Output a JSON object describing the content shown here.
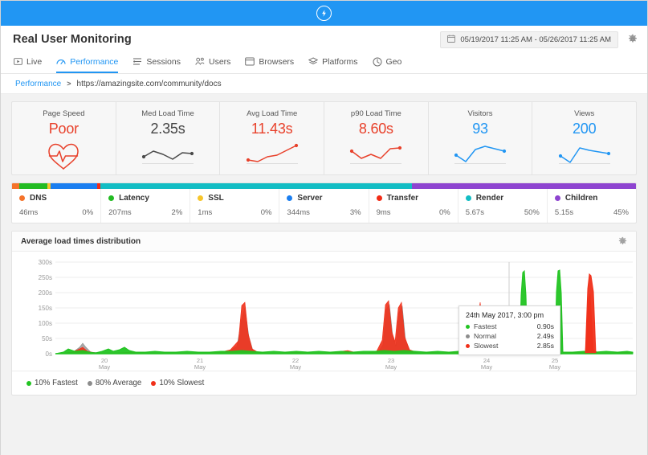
{
  "header": {
    "logo_icon": "lightning-bolt-circle-icon",
    "bar_color": "#2196f3"
  },
  "title_bar": {
    "title": "Real User Monitoring",
    "date_range": "05/19/2017 11:25 AM - 05/26/2017 11:25 AM",
    "calendar_icon": "calendar-icon",
    "settings_icon": "gear-icon"
  },
  "tabs": [
    {
      "label": "Live",
      "icon": "live-play-icon",
      "active": false
    },
    {
      "label": "Performance",
      "icon": "gauge-icon",
      "active": true
    },
    {
      "label": "Sessions",
      "icon": "sessions-list-icon",
      "active": false
    },
    {
      "label": "Users",
      "icon": "users-icon",
      "active": false
    },
    {
      "label": "Browsers",
      "icon": "browser-window-icon",
      "active": false
    },
    {
      "label": "Platforms",
      "icon": "layers-icon",
      "active": false
    },
    {
      "label": "Geo",
      "icon": "globe-clock-icon",
      "active": false
    }
  ],
  "breadcrumb": {
    "root": "Performance",
    "separator": ">",
    "current": "https://amazingsite.com/community/docs"
  },
  "metrics": [
    {
      "label": "Page Speed",
      "value": "Poor",
      "color": "#e8412b",
      "spark": "heart-pulse-icon"
    },
    {
      "label": "Med Load Time",
      "value": "2.35s",
      "color": "#444444",
      "spark": "sparkline"
    },
    {
      "label": "Avg Load Time",
      "value": "11.43s",
      "color": "#e8412b",
      "spark": "sparkline"
    },
    {
      "label": "p90 Load Time",
      "value": "8.60s",
      "color": "#e8412b",
      "spark": "sparkline"
    },
    {
      "label": "Visitors",
      "value": "93",
      "color": "#2196f3",
      "spark": "sparkline"
    },
    {
      "label": "Views",
      "value": "200",
      "color": "#2196f3",
      "spark": "sparkline"
    }
  ],
  "breakdown": {
    "segments": [
      {
        "name": "DNS",
        "time": "46ms",
        "percent": "0%",
        "color": "#f5732a",
        "width": 1.2
      },
      {
        "name": "Latency",
        "time": "207ms",
        "percent": "2%",
        "color": "#22bb22",
        "width": 4.5
      },
      {
        "name": "SSL",
        "time": "1ms",
        "percent": "0%",
        "color": "#f7c52b",
        "width": 0.5
      },
      {
        "name": "Server",
        "time": "344ms",
        "percent": "3%",
        "color": "#1a7ef0",
        "width": 7.5
      },
      {
        "name": "Transfer",
        "time": "9ms",
        "percent": "0%",
        "color": "#f22b15",
        "width": 0.4
      },
      {
        "name": "Render",
        "time": "5.67s",
        "percent": "50%",
        "color": "#12bdc4",
        "width": 50
      },
      {
        "name": "Children",
        "time": "5.15s",
        "percent": "45%",
        "color": "#8e44d0",
        "width": 35.9
      }
    ]
  },
  "chart_panel": {
    "title": "Average load times distribution",
    "settings_icon": "gear-icon"
  },
  "chart_data": {
    "type": "area",
    "title": "Average load times distribution",
    "xlabel": "",
    "ylabel": "",
    "ylim": [
      0,
      320
    ],
    "yticks": [
      "0s",
      "50s",
      "100s",
      "150s",
      "200s",
      "250s",
      "300s"
    ],
    "ytick_values": [
      0,
      50,
      100,
      150,
      200,
      250,
      300
    ],
    "xticks": [
      "20\nMay",
      "21\nMay",
      "22\nMay",
      "23\nMay",
      "24\nMay",
      "25\nMay"
    ],
    "xtick_labels": [
      {
        "day": "20",
        "month": "May"
      },
      {
        "day": "21",
        "month": "May"
      },
      {
        "day": "22",
        "month": "May"
      },
      {
        "day": "23",
        "month": "May"
      },
      {
        "day": "24",
        "month": "May"
      },
      {
        "day": "25",
        "month": "May"
      }
    ],
    "grid": true,
    "legend_position": "bottom",
    "series": [
      {
        "name": "10% Fastest",
        "color": "#22c422",
        "peaks": [
          {
            "x": 62,
            "y": 290
          },
          {
            "x": 73,
            "y": 290
          },
          {
            "x": 7,
            "y": 12
          },
          {
            "x": 14,
            "y": 10
          },
          {
            "x": 22,
            "y": 14
          }
        ]
      },
      {
        "name": "80% Average",
        "color": "#8c8c8c",
        "peaks": [
          {
            "x": 6,
            "y": 32
          },
          {
            "x": 39,
            "y": 128
          },
          {
            "x": 52,
            "y": 150
          },
          {
            "x": 55,
            "y": 148
          },
          {
            "x": 67,
            "y": 122
          }
        ]
      },
      {
        "name": "10% Slowest",
        "color": "#f0301a",
        "peaks": [
          {
            "x": 39,
            "y": 152
          },
          {
            "x": 52,
            "y": 168
          },
          {
            "x": 55,
            "y": 165
          },
          {
            "x": 67,
            "y": 150
          },
          {
            "x": 84,
            "y": 268
          }
        ]
      }
    ]
  },
  "tooltip": {
    "title": "24th May 2017, 3:00 pm",
    "rows": [
      {
        "name": "Fastest",
        "value": "0.90s",
        "color": "#22c422"
      },
      {
        "name": "Normal",
        "value": "2.49s",
        "color": "#8c8c8c"
      },
      {
        "name": "Slowest",
        "value": "2.85s",
        "color": "#f0301a"
      }
    ]
  },
  "chart_legend": [
    {
      "label": "10% Fastest",
      "color": "#22c422"
    },
    {
      "label": "80% Average",
      "color": "#8c8c8c"
    },
    {
      "label": "10% Slowest",
      "color": "#f0301a"
    }
  ]
}
